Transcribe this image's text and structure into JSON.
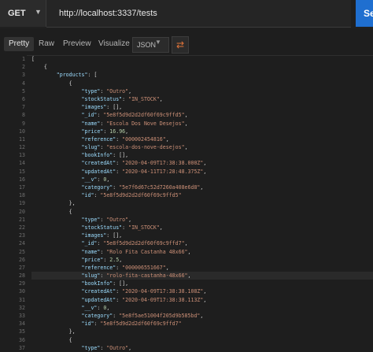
{
  "request": {
    "method": "GET",
    "url": "http://localhost:3337/tests",
    "send_label": "Send"
  },
  "response_tabs": [
    {
      "label": "Pretty",
      "active": true
    },
    {
      "label": "Raw",
      "active": false
    },
    {
      "label": "Preview",
      "active": false
    },
    {
      "label": "Visualize",
      "active": false
    }
  ],
  "format_select": "JSON",
  "icons": {
    "method_caret": "chevron-down-icon",
    "format_caret": "chevron-down-icon",
    "wrap": "wrap-lines-icon"
  },
  "colors": {
    "send": "#1f6fd0",
    "key": "#9cdcfe",
    "string": "#ce9178",
    "number": "#b5cea8",
    "wrap_icon": "#e2743a"
  },
  "highlighted_line": 28,
  "lines": [
    {
      "n": 1,
      "indent": 0,
      "tokens": [
        {
          "t": "p",
          "v": "["
        }
      ]
    },
    {
      "n": 2,
      "indent": 1,
      "tokens": [
        {
          "t": "p",
          "v": "{"
        }
      ]
    },
    {
      "n": 3,
      "indent": 2,
      "tokens": [
        {
          "t": "k",
          "v": "\"products\""
        },
        {
          "t": "p",
          "v": ": ["
        }
      ]
    },
    {
      "n": 4,
      "indent": 3,
      "tokens": [
        {
          "t": "p",
          "v": "{"
        }
      ]
    },
    {
      "n": 5,
      "indent": 4,
      "tokens": [
        {
          "t": "k",
          "v": "\"type\""
        },
        {
          "t": "p",
          "v": ": "
        },
        {
          "t": "s",
          "v": "\"Outro\""
        },
        {
          "t": "p",
          "v": ","
        }
      ]
    },
    {
      "n": 6,
      "indent": 4,
      "tokens": [
        {
          "t": "k",
          "v": "\"stockStatus\""
        },
        {
          "t": "p",
          "v": ": "
        },
        {
          "t": "s",
          "v": "\"IN_STOCK\""
        },
        {
          "t": "p",
          "v": ","
        }
      ]
    },
    {
      "n": 7,
      "indent": 4,
      "tokens": [
        {
          "t": "k",
          "v": "\"images\""
        },
        {
          "t": "p",
          "v": ": [],"
        }
      ]
    },
    {
      "n": 8,
      "indent": 4,
      "tokens": [
        {
          "t": "k",
          "v": "\"_id\""
        },
        {
          "t": "p",
          "v": ": "
        },
        {
          "t": "s",
          "v": "\"5e8f5d9d2d2df60f69c9ffd5\""
        },
        {
          "t": "p",
          "v": ","
        }
      ]
    },
    {
      "n": 9,
      "indent": 4,
      "tokens": [
        {
          "t": "k",
          "v": "\"name\""
        },
        {
          "t": "p",
          "v": ": "
        },
        {
          "t": "s",
          "v": "\"Escola Dos Nove Desejos\""
        },
        {
          "t": "p",
          "v": ","
        }
      ]
    },
    {
      "n": 10,
      "indent": 4,
      "tokens": [
        {
          "t": "k",
          "v": "\"price\""
        },
        {
          "t": "p",
          "v": ": "
        },
        {
          "t": "n",
          "v": "16.96"
        },
        {
          "t": "p",
          "v": ","
        }
      ]
    },
    {
      "n": 11,
      "indent": 4,
      "tokens": [
        {
          "t": "k",
          "v": "\"reference\""
        },
        {
          "t": "p",
          "v": ": "
        },
        {
          "t": "s",
          "v": "\"000002454816\""
        },
        {
          "t": "p",
          "v": ","
        }
      ]
    },
    {
      "n": 12,
      "indent": 4,
      "tokens": [
        {
          "t": "k",
          "v": "\"slug\""
        },
        {
          "t": "p",
          "v": ": "
        },
        {
          "t": "s",
          "v": "\"escola-dos-nove-desejos\""
        },
        {
          "t": "p",
          "v": ","
        }
      ]
    },
    {
      "n": 13,
      "indent": 4,
      "tokens": [
        {
          "t": "k",
          "v": "\"bookInfo\""
        },
        {
          "t": "p",
          "v": ": [],"
        }
      ]
    },
    {
      "n": 14,
      "indent": 4,
      "tokens": [
        {
          "t": "k",
          "v": "\"createdAt\""
        },
        {
          "t": "p",
          "v": ": "
        },
        {
          "t": "s",
          "v": "\"2020-04-09T17:38:38.000Z\""
        },
        {
          "t": "p",
          "v": ","
        }
      ]
    },
    {
      "n": 15,
      "indent": 4,
      "tokens": [
        {
          "t": "k",
          "v": "\"updatedAt\""
        },
        {
          "t": "p",
          "v": ": "
        },
        {
          "t": "s",
          "v": "\"2020-04-11T17:28:48.375Z\""
        },
        {
          "t": "p",
          "v": ","
        }
      ]
    },
    {
      "n": 16,
      "indent": 4,
      "tokens": [
        {
          "t": "k",
          "v": "\"__v\""
        },
        {
          "t": "p",
          "v": ": "
        },
        {
          "t": "n",
          "v": "0"
        },
        {
          "t": "p",
          "v": ","
        }
      ]
    },
    {
      "n": 17,
      "indent": 4,
      "tokens": [
        {
          "t": "k",
          "v": "\"category\""
        },
        {
          "t": "p",
          "v": ": "
        },
        {
          "t": "s",
          "v": "\"5e7f6d67c52d7260a408e6d8\""
        },
        {
          "t": "p",
          "v": ","
        }
      ]
    },
    {
      "n": 18,
      "indent": 4,
      "tokens": [
        {
          "t": "k",
          "v": "\"id\""
        },
        {
          "t": "p",
          "v": ": "
        },
        {
          "t": "s",
          "v": "\"5e8f5d9d2d2df60f69c9ffd5\""
        }
      ]
    },
    {
      "n": 19,
      "indent": 3,
      "tokens": [
        {
          "t": "p",
          "v": "},"
        }
      ]
    },
    {
      "n": 20,
      "indent": 3,
      "tokens": [
        {
          "t": "p",
          "v": "{"
        }
      ]
    },
    {
      "n": 21,
      "indent": 4,
      "tokens": [
        {
          "t": "k",
          "v": "\"type\""
        },
        {
          "t": "p",
          "v": ": "
        },
        {
          "t": "s",
          "v": "\"Outro\""
        },
        {
          "t": "p",
          "v": ","
        }
      ]
    },
    {
      "n": 22,
      "indent": 4,
      "tokens": [
        {
          "t": "k",
          "v": "\"stockStatus\""
        },
        {
          "t": "p",
          "v": ": "
        },
        {
          "t": "s",
          "v": "\"IN_STOCK\""
        },
        {
          "t": "p",
          "v": ","
        }
      ]
    },
    {
      "n": 23,
      "indent": 4,
      "tokens": [
        {
          "t": "k",
          "v": "\"images\""
        },
        {
          "t": "p",
          "v": ": [],"
        }
      ]
    },
    {
      "n": 24,
      "indent": 4,
      "tokens": [
        {
          "t": "k",
          "v": "\"_id\""
        },
        {
          "t": "p",
          "v": ": "
        },
        {
          "t": "s",
          "v": "\"5e8f5d9d2d2df60f69c9ffd7\""
        },
        {
          "t": "p",
          "v": ","
        }
      ]
    },
    {
      "n": 25,
      "indent": 4,
      "tokens": [
        {
          "t": "k",
          "v": "\"name\""
        },
        {
          "t": "p",
          "v": ": "
        },
        {
          "t": "s",
          "v": "\"Rolo Fita Castanha 48x66\""
        },
        {
          "t": "p",
          "v": ","
        }
      ]
    },
    {
      "n": 26,
      "indent": 4,
      "tokens": [
        {
          "t": "k",
          "v": "\"price\""
        },
        {
          "t": "p",
          "v": ": "
        },
        {
          "t": "n",
          "v": "2.5"
        },
        {
          "t": "p",
          "v": ","
        }
      ]
    },
    {
      "n": 27,
      "indent": 4,
      "tokens": [
        {
          "t": "k",
          "v": "\"reference\""
        },
        {
          "t": "p",
          "v": ": "
        },
        {
          "t": "s",
          "v": "\"000006551667\""
        },
        {
          "t": "p",
          "v": ","
        }
      ]
    },
    {
      "n": 28,
      "indent": 4,
      "tokens": [
        {
          "t": "k",
          "v": "\"slug\""
        },
        {
          "t": "p",
          "v": ": "
        },
        {
          "t": "s",
          "v": "\"rolo-fita-castanha-48x66\""
        },
        {
          "t": "p",
          "v": ","
        }
      ]
    },
    {
      "n": 29,
      "indent": 4,
      "tokens": [
        {
          "t": "k",
          "v": "\"bookInfo\""
        },
        {
          "t": "p",
          "v": ": [],"
        }
      ]
    },
    {
      "n": 30,
      "indent": 4,
      "tokens": [
        {
          "t": "k",
          "v": "\"createdAt\""
        },
        {
          "t": "p",
          "v": ": "
        },
        {
          "t": "s",
          "v": "\"2020-04-09T17:38:38.108Z\""
        },
        {
          "t": "p",
          "v": ","
        }
      ]
    },
    {
      "n": 31,
      "indent": 4,
      "tokens": [
        {
          "t": "k",
          "v": "\"updatedAt\""
        },
        {
          "t": "p",
          "v": ": "
        },
        {
          "t": "s",
          "v": "\"2020-04-09T17:38:38.113Z\""
        },
        {
          "t": "p",
          "v": ","
        }
      ]
    },
    {
      "n": 32,
      "indent": 4,
      "tokens": [
        {
          "t": "k",
          "v": "\"__v\""
        },
        {
          "t": "p",
          "v": ": "
        },
        {
          "t": "n",
          "v": "0"
        },
        {
          "t": "p",
          "v": ","
        }
      ]
    },
    {
      "n": 33,
      "indent": 4,
      "tokens": [
        {
          "t": "k",
          "v": "\"category\""
        },
        {
          "t": "p",
          "v": ": "
        },
        {
          "t": "s",
          "v": "\"5e8f5ae51004f205d9b585bd\""
        },
        {
          "t": "p",
          "v": ","
        }
      ]
    },
    {
      "n": 34,
      "indent": 4,
      "tokens": [
        {
          "t": "k",
          "v": "\"id\""
        },
        {
          "t": "p",
          "v": ": "
        },
        {
          "t": "s",
          "v": "\"5e8f5d9d2d2df60f69c9ffd7\""
        }
      ]
    },
    {
      "n": 35,
      "indent": 3,
      "tokens": [
        {
          "t": "p",
          "v": "},"
        }
      ]
    },
    {
      "n": 36,
      "indent": 3,
      "tokens": [
        {
          "t": "p",
          "v": "{"
        }
      ]
    },
    {
      "n": 37,
      "indent": 4,
      "tokens": [
        {
          "t": "k",
          "v": "\"type\""
        },
        {
          "t": "p",
          "v": ": "
        },
        {
          "t": "s",
          "v": "\"Outro\""
        },
        {
          "t": "p",
          "v": ","
        }
      ]
    }
  ]
}
